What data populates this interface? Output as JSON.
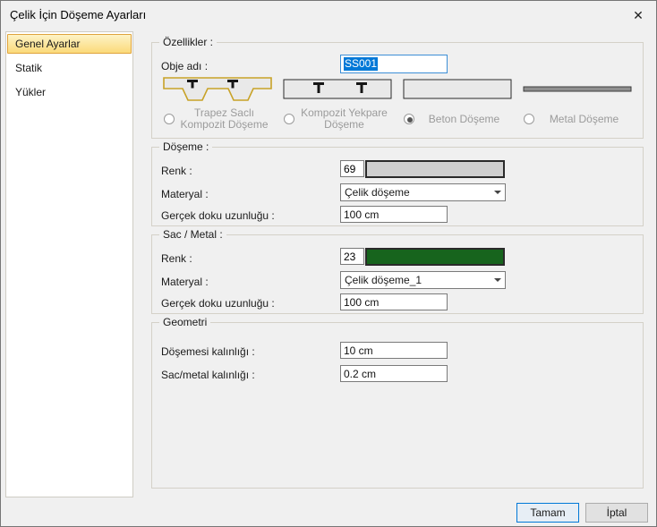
{
  "window": {
    "title": "Çelik İçin Döşeme Ayarları",
    "close_glyph": "✕"
  },
  "accent": "#0078d7",
  "sidebar": {
    "items": [
      {
        "label": "Genel Ayarlar",
        "selected": true
      },
      {
        "label": "Statik",
        "selected": false
      },
      {
        "label": "Yükler",
        "selected": false
      }
    ]
  },
  "ozellikler": {
    "label": "Özellikler :",
    "obje_adi": {
      "label": "Obje adı :",
      "value": "SS001"
    },
    "options": [
      {
        "label": "Trapez Saclı\nKompozit Döşeme",
        "selected": false,
        "image": "trapez-deck-image"
      },
      {
        "label": "Kompozit Yekpare\nDöşeme",
        "selected": false,
        "image": "composite-slab-image"
      },
      {
        "label": "Beton Döşeme",
        "selected": true,
        "image": "concrete-slab-image"
      },
      {
        "label": "Metal Döşeme",
        "selected": false,
        "image": "metal-deck-image"
      }
    ]
  },
  "doseme": {
    "label": "Döşeme :",
    "renk": {
      "label": "Renk :",
      "value": "69",
      "color": "#cfcfcf"
    },
    "materyal": {
      "label": "Materyal :",
      "value": "Çelik döşeme"
    },
    "doku": {
      "label": "Gerçek doku uzunluğu :",
      "value": "100 cm"
    }
  },
  "sac_metal": {
    "label": "Sac / Metal :",
    "renk": {
      "label": "Renk :",
      "value": "23",
      "color": "#17641d"
    },
    "materyal": {
      "label": "Materyal :",
      "value": "Çelik döşeme_1"
    },
    "doku": {
      "label": "Gerçek doku uzunluğu :",
      "value": "100 cm"
    }
  },
  "geometri": {
    "label": "Geometri",
    "doseme_kalinligi": {
      "label": "Döşemesi kalınlığı :",
      "value": "10 cm"
    },
    "sac_kalinligi": {
      "label": "Sac/metal kalınlığı :",
      "value": "0.2 cm"
    }
  },
  "footer": {
    "ok_label": "Tamam",
    "cancel_label": "İptal"
  }
}
